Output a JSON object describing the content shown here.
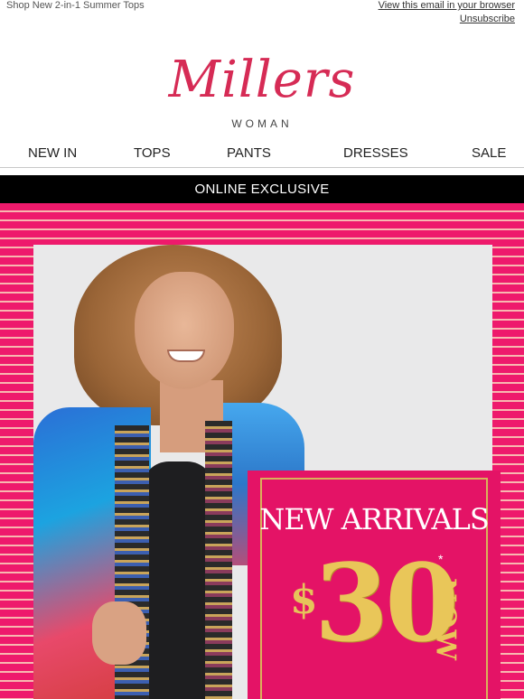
{
  "topbar": {
    "preheader": "Shop New 2-in-1 Summer Tops",
    "view_link": "View this email in your browser",
    "unsubscribe": "Unsubscribe"
  },
  "logo": {
    "script": "Millers",
    "sub": "WOMAN",
    "color": "#d62b55"
  },
  "nav": {
    "items": [
      {
        "label": "NEW IN"
      },
      {
        "label": "TOPS"
      },
      {
        "label": "PANTS"
      },
      {
        "label": "DRESSES"
      },
      {
        "label": "SALE"
      }
    ]
  },
  "banner": {
    "text": "ONLINE EXCLUSIVE"
  },
  "hero": {
    "promo_title": "NEW ARRIVALS",
    "currency": "$",
    "price": "30",
    "asterisk": "*",
    "now": "NOW",
    "accent": "#ee1a6c",
    "gold": "#e9c659"
  }
}
